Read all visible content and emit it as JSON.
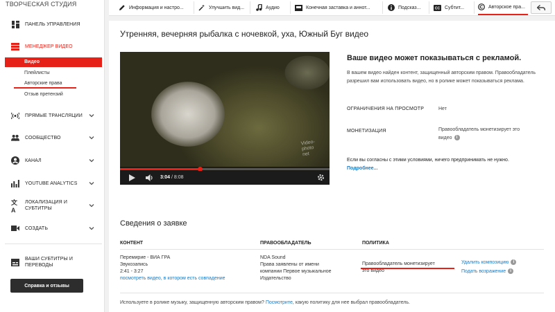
{
  "sidebar": {
    "studio_title": "ТВОРЧЕСКАЯ СТУДИЯ",
    "dashboard": "ПАНЕЛЬ УПРАВЛЕНИЯ",
    "video_manager": "МЕНЕДЖЕР ВИДЕО",
    "sub_items": [
      "Видео",
      "Плейлисты",
      "Авторские права",
      "Отзыв претензий"
    ],
    "sections": [
      {
        "label": "ПРЯМЫЕ ТРАНСЛЯЦИИ",
        "icon": "broadcast-icon"
      },
      {
        "label": "СООБЩЕСТВО",
        "icon": "people-icon"
      },
      {
        "label": "КАНАЛ",
        "icon": "account-icon"
      },
      {
        "label": "YOUTUBE ANALYTICS",
        "icon": "analytics-icon"
      },
      {
        "label": "ЛОКАЛИЗАЦИЯ И СУБТИТРЫ",
        "icon": "translate-icon"
      },
      {
        "label": "СОЗДАТЬ",
        "icon": "camera-icon"
      },
      {
        "label": "ВАШИ СУБТИТРЫ И ПЕРЕВОДЫ",
        "icon": "subtitles-icon"
      }
    ],
    "help_button": "Справка и отзывы"
  },
  "tabs": [
    {
      "label": "Информация и настро...",
      "icon": "pencil-icon"
    },
    {
      "label": "Улучшить вид...",
      "icon": "magic-wand-icon"
    },
    {
      "label": "Аудио",
      "icon": "music-note-icon"
    },
    {
      "label": "Конечная заставка и аннот...",
      "icon": "end-screen-icon"
    },
    {
      "label": "Подсказ...",
      "icon": "info-icon"
    },
    {
      "label": "Субтит...",
      "icon": "cc-icon"
    },
    {
      "label": "Авторское пра...",
      "icon": "copyright-icon"
    }
  ],
  "main": {
    "video_title": "Утренняя, вечерняя рыбалка с ночевкой, уха, Южный Буг видео",
    "player": {
      "current_time": "3:04",
      "duration": "8:08",
      "progress_fraction": 0.38,
      "watermark_line1": "Video-",
      "watermark_line2": "photo",
      "watermark_line3": "net"
    },
    "ad_heading": "Ваше видео может показываться с рекламой.",
    "ad_description": "В вашем видео найден контент, защищенный авторским правом. Правообладатель разрешил вам использовать видео, но в ролике может показываться реклама.",
    "restrictions_label": "ОГРАНИЧЕНИЯ НА ПРОСМОТР",
    "restrictions_value": "Нет",
    "monetization_label": "МОНЕТИЗАЦИЯ",
    "monetization_value": "Правообладатель монетизирует это видео",
    "agree_text": "Если вы согласны с этими условиями, ничего предпринимать не нужно.",
    "more_link": "Подробнее...",
    "claim_section_title": "Сведения о заявке",
    "table_headers": {
      "content": "КОНТЕНТ",
      "owner": "ПРАВООБЛАДАТЕЛЬ",
      "policy": "ПОЛИТИКА"
    },
    "claim": {
      "content_title": "Перемирие - ВИА ГРА",
      "content_type": "Звукозапись",
      "content_range": "2:41 - 3:27",
      "content_link": "посмотреть видео, в котором есть совпадение",
      "owner_name": "NDA Sound",
      "owner_line2": "Права заявлены от имени",
      "owner_line3": "компании Первое музыкальное",
      "owner_line4": "Издательство",
      "policy_line1": "Правообладатель монетизирует",
      "policy_line2": "это видео",
      "remove_song": "Удалить композицию",
      "dispute": "Подать возражение"
    },
    "footer_prefix": "Используете в ролике музыку, защищенную авторским правом?",
    "footer_link": "Посмотрите",
    "footer_suffix": ", какую политику для нее выбрал правообладатель."
  },
  "colors": {
    "accent": "#e62117",
    "link": "#167ac6"
  }
}
